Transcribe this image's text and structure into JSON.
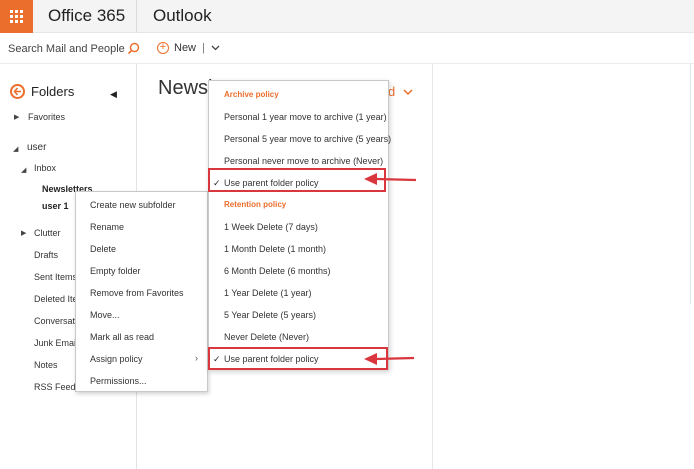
{
  "header": {
    "brand": "Office 365",
    "app_name": "Outlook"
  },
  "search": {
    "placeholder": "Search Mail and People"
  },
  "toolbar": {
    "new_label": "New",
    "separator": "|"
  },
  "folders": {
    "title": "Folders",
    "items": [
      {
        "label": "Favorites"
      },
      {
        "label": "user"
      },
      {
        "label": "Inbox"
      },
      {
        "label": "Newsletters"
      },
      {
        "label": "user 1"
      },
      {
        "label": "Clutter"
      },
      {
        "label": "Drafts"
      },
      {
        "label": "Sent Items"
      },
      {
        "label": "Deleted Ite"
      },
      {
        "label": "Conversati"
      },
      {
        "label": "Junk Email"
      },
      {
        "label": "Notes"
      },
      {
        "label": "RSS Feeds"
      }
    ]
  },
  "list_pane": {
    "title": "Newsl",
    "dropdown_fragment": "d"
  },
  "context_menu": {
    "items": [
      {
        "label": "Create new subfolder"
      },
      {
        "label": "Rename"
      },
      {
        "label": "Delete"
      },
      {
        "label": "Empty folder"
      },
      {
        "label": "Remove from Favorites"
      },
      {
        "label": "Move..."
      },
      {
        "label": "Mark all as read"
      },
      {
        "label": "Assign policy"
      },
      {
        "label": "Permissions..."
      }
    ]
  },
  "policy_menu": {
    "archive_header": "Archive policy",
    "archive_items": [
      {
        "label": "Personal 1 year move to archive (1 year)"
      },
      {
        "label": "Personal 5 year move to archive (5 years)"
      },
      {
        "label": "Personal never move to archive (Never)"
      },
      {
        "label": "Use parent folder policy",
        "checked": true
      }
    ],
    "retention_header": "Retention policy",
    "retention_items": [
      {
        "label": "1 Week Delete (7 days)"
      },
      {
        "label": "1 Month Delete (1 month)"
      },
      {
        "label": "6 Month Delete (6 months)"
      },
      {
        "label": "1 Year Delete (1 year)"
      },
      {
        "label": "5 Year Delete (5 years)"
      },
      {
        "label": "Never Delete (Never)"
      },
      {
        "label": "Use parent folder policy",
        "checked": true
      }
    ]
  },
  "colors": {
    "accent": "#eb6e2c",
    "annotation": "#d9363e"
  }
}
